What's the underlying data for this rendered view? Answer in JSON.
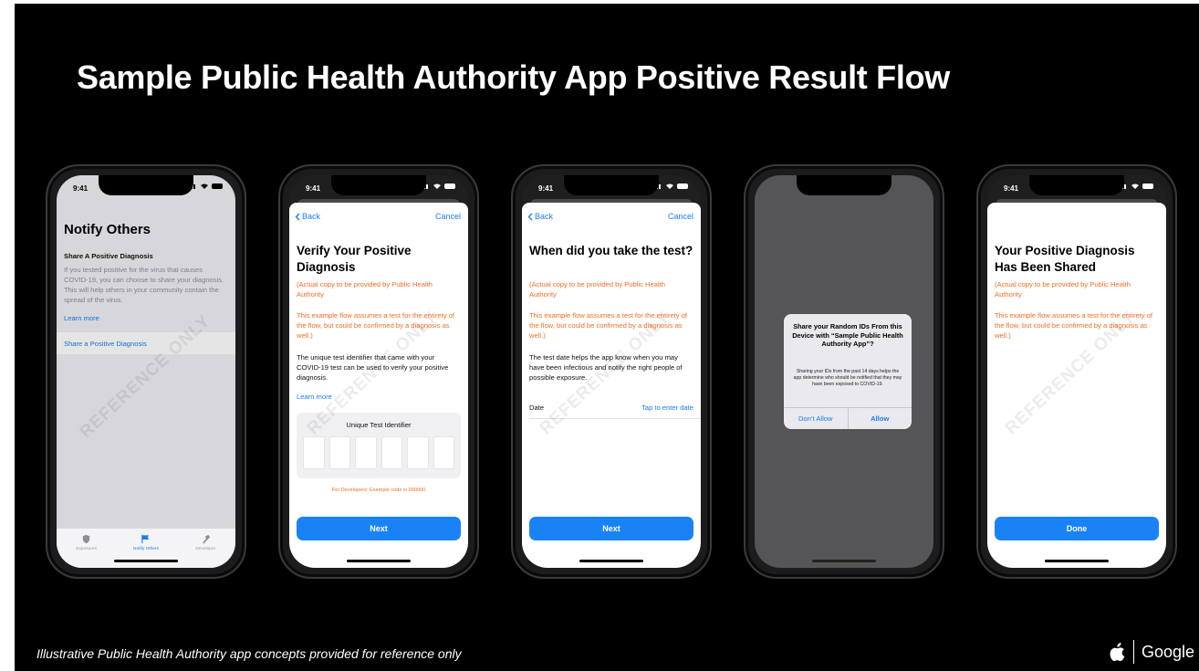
{
  "slide_title": "Sample Public Health Authority App Positive Result Flow",
  "footnote": "Illustrative Public Health Authority app concepts provided for reference only",
  "brand": {
    "google": "Google",
    "apple_icon": "apple-logo-icon"
  },
  "watermark": "REFERENCE ONLY",
  "status_time": "9:41",
  "colors": {
    "accent_blue": "#1a82f7",
    "orange": "#f06d22",
    "background": "#000000"
  },
  "phone1": {
    "title": "Notify Others",
    "section_heading": "Share A Positive Diagnosis",
    "description": "If you tested positive for the virus that causes COVID-19, you can choose to share your diagnosis. This will help others in your community contain the spread of the virus.",
    "learn_more": "Learn more",
    "share_link": "Share a Positive Diagnosis",
    "tabs": [
      {
        "label": "Exposures",
        "icon": "shield-icon"
      },
      {
        "label": "Notify Others",
        "icon": "flag-icon"
      },
      {
        "label": "Developer",
        "icon": "hammer-icon"
      }
    ]
  },
  "phone2": {
    "back": "Back",
    "cancel": "Cancel",
    "title": "Verify Your Positive Diagnosis",
    "copy_note": "(Actual copy to be provided by Public Health Authority",
    "flow_note": "This example flow assumes a test for the entirety of the flow, but could be confirmed by a diagnosis as well.)",
    "body": "The unique test identifier that came with your COVID-19 test can be used to verify your positive diagnosis.",
    "learn_more": "Learn more",
    "code_label": "Unique Test Identifier",
    "dev_note": "For Developers: Example code is 000000",
    "button": "Next"
  },
  "phone3": {
    "back": "Back",
    "cancel": "Cancel",
    "title": "When did you take the test?",
    "copy_note": "(Actual copy to be provided by Public Health Authority",
    "flow_note": "This example flow assumes a test for the entirety of the flow, but could be confirmed by a diagnosis as well.)",
    "body": "The test date helps the app know when you may have been infectious and notify the right people of possible exposure.",
    "date_label": "Date",
    "date_value": "Tap to enter date",
    "button": "Next"
  },
  "phone4": {
    "alert_title": "Share your Random IDs From this Device with “Sample Public Health Authority App”?",
    "alert_message": "Sharing your IDs from the past 14 days helps the app determine who should be notified that they may have been exposed to COVID-19.",
    "dont_allow": "Don’t Allow",
    "allow": "Allow"
  },
  "phone5": {
    "title": "Your Positive Diagnosis Has Been Shared",
    "copy_note": "(Actual copy to be provided by Public Health Authority",
    "flow_note": "This example flow assumes a test for the entirety of the flow, but could be confirmed by a diagnosis as well.)",
    "button": "Done"
  }
}
